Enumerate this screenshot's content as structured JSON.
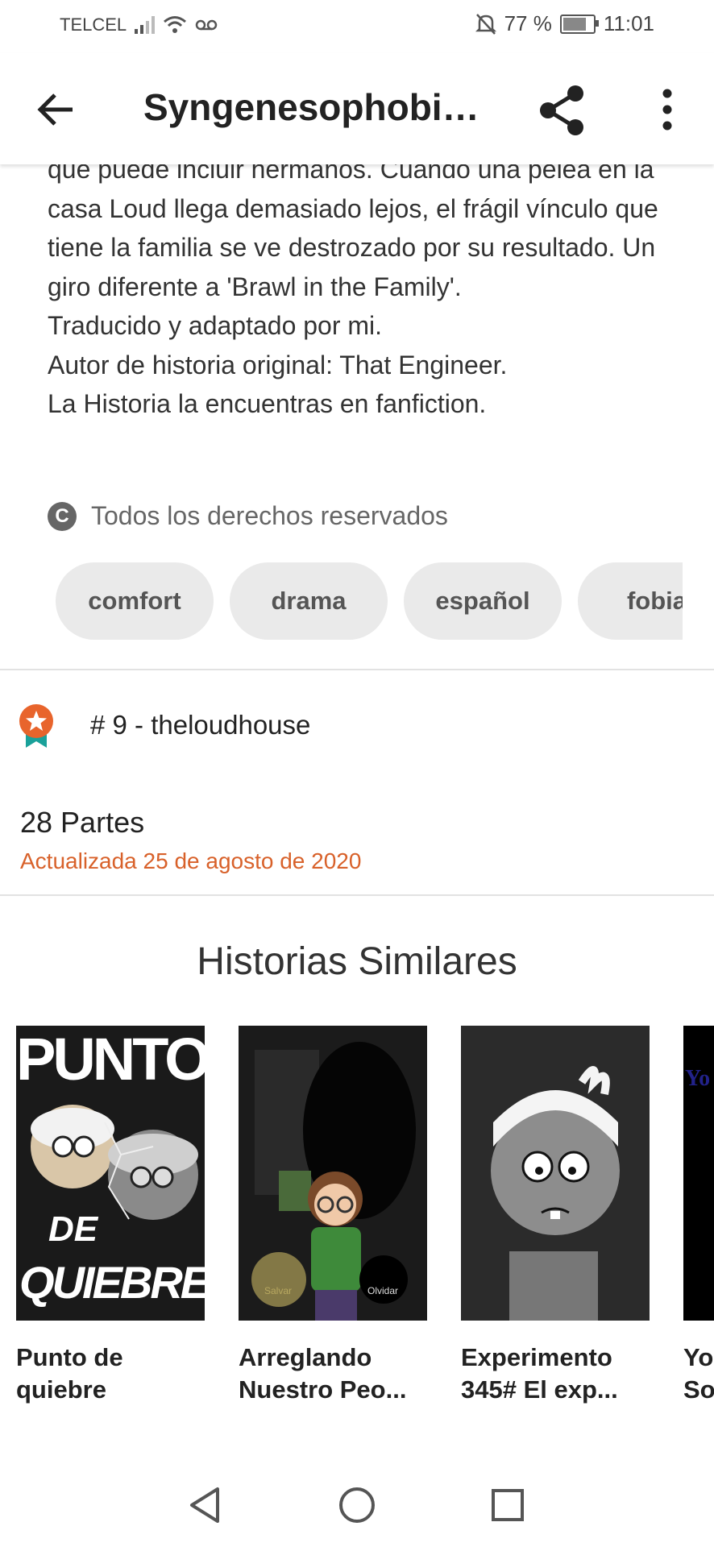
{
  "status_bar": {
    "carrier": "TELCEL",
    "battery_text": "77 %",
    "battery_level": 0.77,
    "time": "11:01",
    "icons": [
      "signal-icon",
      "wifi-icon",
      "voicemail-icon",
      "mute-icon",
      "battery-icon"
    ]
  },
  "toolbar": {
    "title": "Syngenesophobia...",
    "back_icon": "arrow-left-icon",
    "share_icon": "share-icon",
    "more_icon": "more-vert-icon"
  },
  "description": {
    "lines": [
      "que puede incluir hermanos. Cuando una pelea en la casa Loud llega demasiado lejos, el frágil vínculo que tiene la familia se ve destrozado por su resultado. Un giro diferente a 'Brawl in the Family'.",
      "Traducido y adaptado por mi.",
      "Autor de historia original: That Engineer.",
      "La Historia la encuentras en fanfiction."
    ]
  },
  "copyright": {
    "icon": "copyright-icon",
    "text": "Todos los derechos reservados"
  },
  "tags": [
    "comfort",
    "drama",
    "español",
    "fobia"
  ],
  "ranking": {
    "icon": "ranking-badge-icon",
    "label": "# 9 - theloudhouse"
  },
  "parts": {
    "count_label": "28 Partes",
    "updated": "Actualizada 25 de agosto de 2020"
  },
  "similar": {
    "title": "Historias Similares",
    "stories": [
      {
        "title": "Punto de quiebre",
        "cover_text_top": "PUNTO",
        "cover_text_mid": "DE",
        "cover_text_bottom": "QUIEBRE"
      },
      {
        "title": "Arreglando Nuestro Peo...",
        "cover_left_label": "Salvar",
        "cover_right_label": "Olvidar"
      },
      {
        "title": "Experimento 345# El exp..."
      },
      {
        "title": "Yo So",
        "cover_text": "Yo"
      }
    ]
  },
  "navbar": {
    "icons": [
      "nav-back-icon",
      "nav-home-icon",
      "nav-recents-icon"
    ]
  },
  "colors": {
    "accent": "#d8612a",
    "tag_bg": "#eaeaea",
    "badge_orange": "#e8642c",
    "badge_teal": "#1aa19a"
  }
}
